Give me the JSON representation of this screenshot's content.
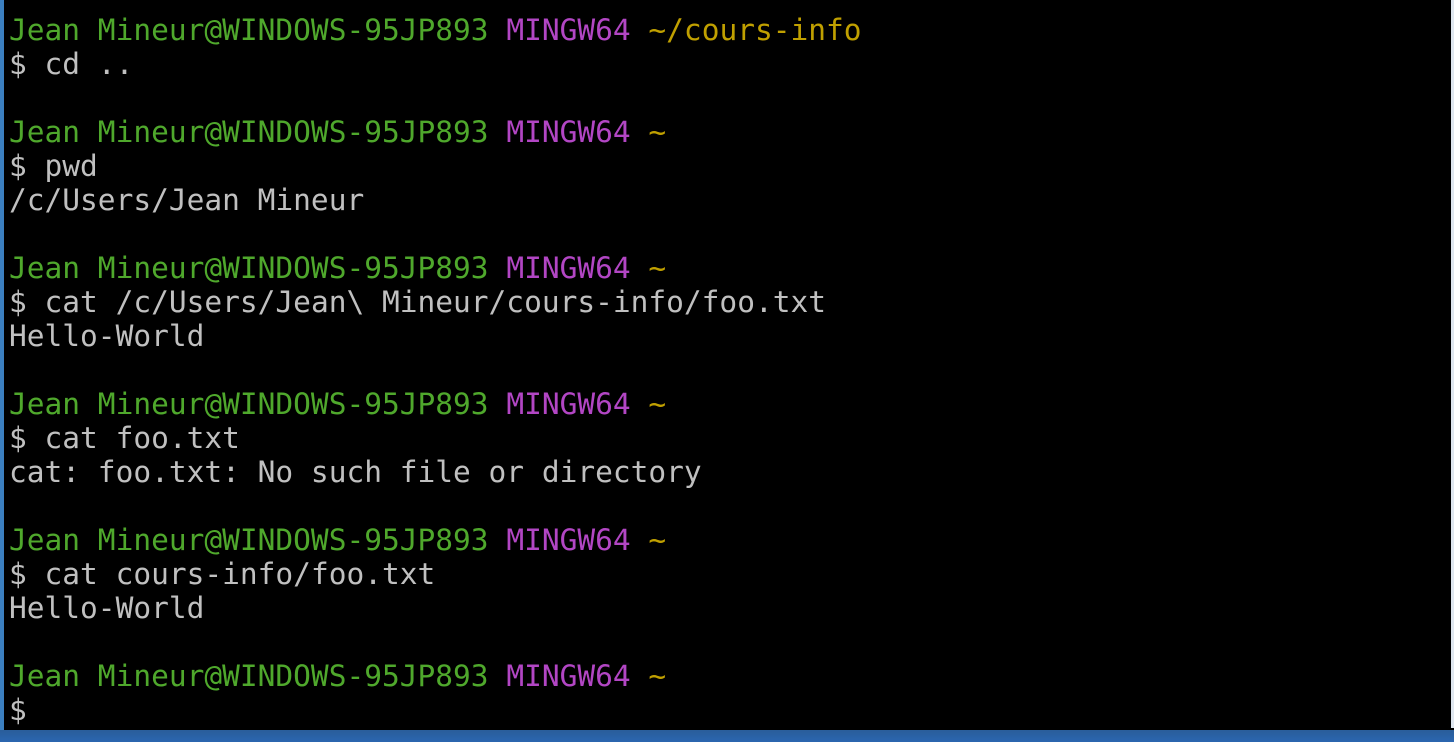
{
  "prompt": {
    "user_host": "Jean Mineur@WINDOWS-95JP893",
    "shell": "MINGW64",
    "symbol": "$"
  },
  "colors": {
    "user_host": "#4fa82c",
    "shell": "#b246c4",
    "path": "#c0a000",
    "text": "#c0c0c0"
  },
  "blocks": [
    {
      "path": "~/cours-info",
      "command": "cd ..",
      "output": ""
    },
    {
      "path": "~",
      "command": "pwd",
      "output": "/c/Users/Jean Mineur"
    },
    {
      "path": "~",
      "command": "cat /c/Users/Jean\\ Mineur/cours-info/foo.txt",
      "output": "Hello-World"
    },
    {
      "path": "~",
      "command": "cat foo.txt",
      "output": "cat: foo.txt: No such file or directory"
    },
    {
      "path": "~",
      "command": "cat cours-info/foo.txt",
      "output": "Hello-World"
    },
    {
      "path": "~",
      "command": "",
      "output": ""
    }
  ]
}
